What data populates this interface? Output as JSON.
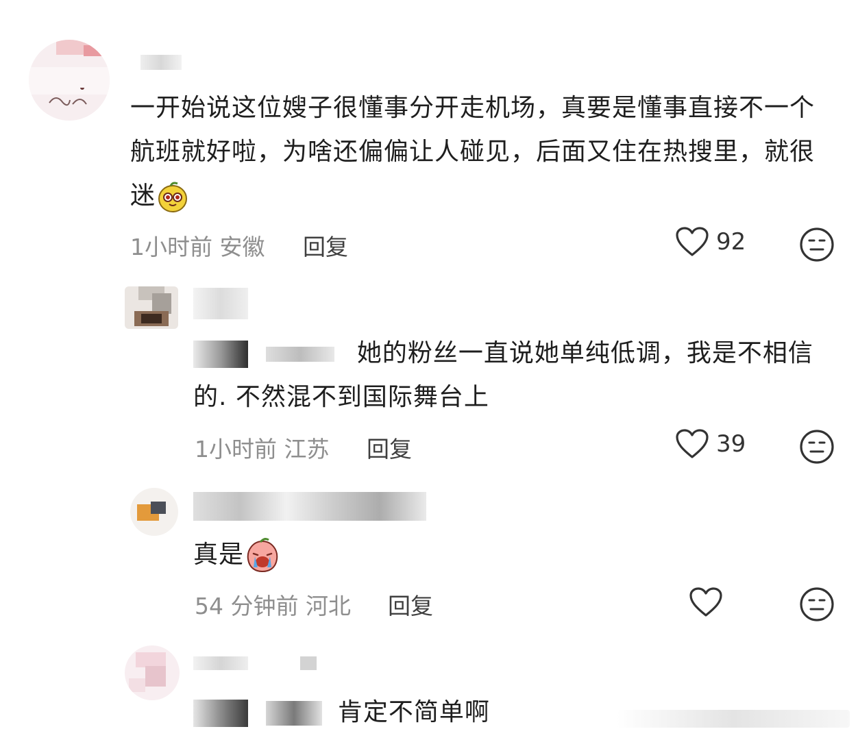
{
  "comments": [
    {
      "level": "top",
      "text": "一开始说这位嫂子很懂事分开走机场，真要是懂事直接不一个航班就好啦，为啥还偏偏让人碰见，后面又住在热搜里，就很迷",
      "emoji": "mango-face-emoji",
      "time": "1小时前",
      "location": "安徽",
      "reply_label": "回复",
      "likes": "92"
    },
    {
      "level": "reply",
      "text": "她的粉丝一直说她单纯低调，我是不相信的. 不然混不到国际舞台上",
      "time": "1小时前",
      "location": "江苏",
      "reply_label": "回复",
      "likes": "39"
    },
    {
      "level": "reply",
      "text": "真是",
      "emoji": "crying-peach-emoji",
      "time": "54 分钟前",
      "location": "河北",
      "reply_label": "回复",
      "likes": ""
    },
    {
      "level": "reply",
      "text": "肯定不简单啊"
    }
  ],
  "icons": {
    "like": "heart-outline-icon",
    "dislike": "neutral-face-icon"
  },
  "colors": {
    "text": "#1e1e1e",
    "meta": "#8e8e8e",
    "icon": "#333333"
  }
}
